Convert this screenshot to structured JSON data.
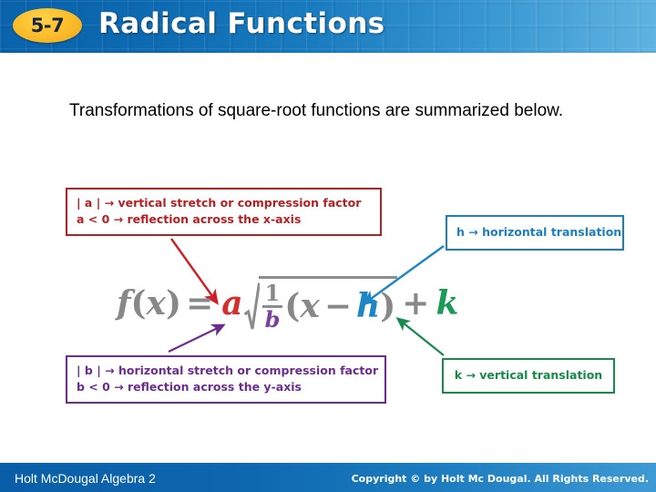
{
  "slide": {
    "lesson_number": "5-7",
    "title": "Radical Functions"
  },
  "intro": {
    "text": "Transformations of square-root functions are summarized below."
  },
  "diagram": {
    "callouts": {
      "a": {
        "line1": "| a | → vertical stretch or compression factor",
        "line2": "a < 0 → reflection across the x-axis",
        "color": "#b52025"
      },
      "h": {
        "line1": "h → horizontal translation",
        "color": "#1b7fbe"
      },
      "b": {
        "line1": "| b | → horizontal stretch or compression factor",
        "line2": "b < 0 → reflection across the y-axis",
        "color": "#6b2d8f"
      },
      "k": {
        "line1": "k → vertical translation",
        "color": "#168a4b"
      }
    },
    "formula": {
      "fx": "f",
      "open1": "(",
      "x1": "x",
      "close1": ")",
      "equals": "=",
      "a": "a",
      "numerator": "1",
      "denominator": "b",
      "open2": "(",
      "x2": "x",
      "minus": "−",
      "h": "h",
      "close2": ")",
      "plus": "+",
      "k": "k",
      "plain_text": "f(x) = a√((1/b)(x − h)) + k"
    }
  },
  "footer": {
    "left": "Holt McDougal Algebra 2",
    "right": "Copyright © by Holt Mc Dougal. All Rights Reserved."
  }
}
